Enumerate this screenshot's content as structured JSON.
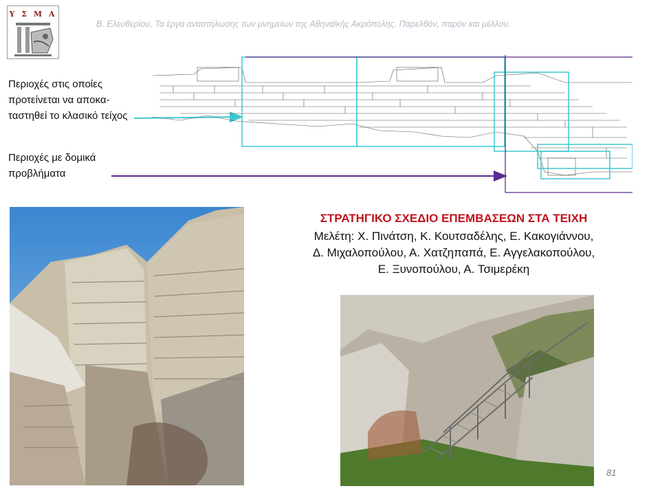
{
  "logo": {
    "text": "Υ Σ Μ Α"
  },
  "header": {
    "citation": "Β. Ελευθερίου, Τα έργα αναστήλωσης των μνημείων της Αθηναϊκής Ακρόπολης. Παρελθόν, παρόν και μέλλον."
  },
  "legend": {
    "restore_label": [
      "Περιοχές στις οποίες",
      "προτείνεται να αποκα-",
      "ταστηθεί το κλασικό τείχος"
    ],
    "structural_label": [
      "Περιοχές με δομικά",
      "προβλήματα"
    ],
    "restore_color": "#3cc8d0",
    "structural_color": "#5b2c8e"
  },
  "title": "ΣΤΡΑΤΗΓΙΚΟ ΣΧΕΔΙΟ ΕΠΕΜΒΑΣΕΩΝ ΣΤΑ ΤΕΙΧΗ",
  "credits": [
    "Μελέτη: Χ. Πινάτση, Κ. Κουτσαδέλης, Ε. Κακογιάννου,",
    "Δ. Μιχαλοπούλου, Α. Χατζηπαπά, Ε. Αγγελακοπούλου,",
    "Ε. Ξυνοπούλου, Α. Τσιμερέκη"
  ],
  "page_number": "81"
}
